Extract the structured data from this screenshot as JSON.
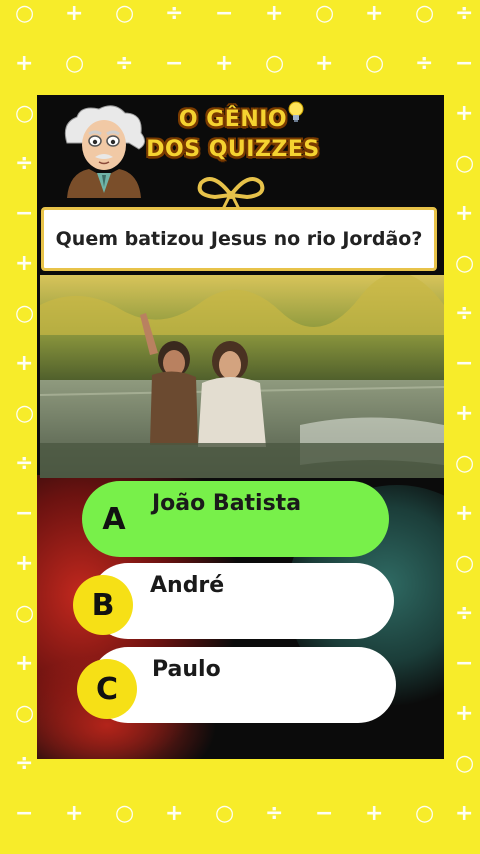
{
  "brand": {
    "line1": "O GÊNIO",
    "line2": "DOS QUIZZES"
  },
  "question": "Quem batizou Jesus no rio Jordão?",
  "answers": [
    {
      "letter": "A",
      "text": "João Batista",
      "state": "correct"
    },
    {
      "letter": "B",
      "text": "André",
      "state": "default"
    },
    {
      "letter": "C",
      "text": "Paulo",
      "state": "default"
    }
  ],
  "colors": {
    "background": "#f7ec2a",
    "correct": "#78f04a",
    "letter_badge": "#f6e016",
    "brand_text": "#f5d330"
  },
  "icons": [
    "einstein-mascot-icon",
    "lightbulb-icon",
    "ribbon-bow-icon"
  ]
}
